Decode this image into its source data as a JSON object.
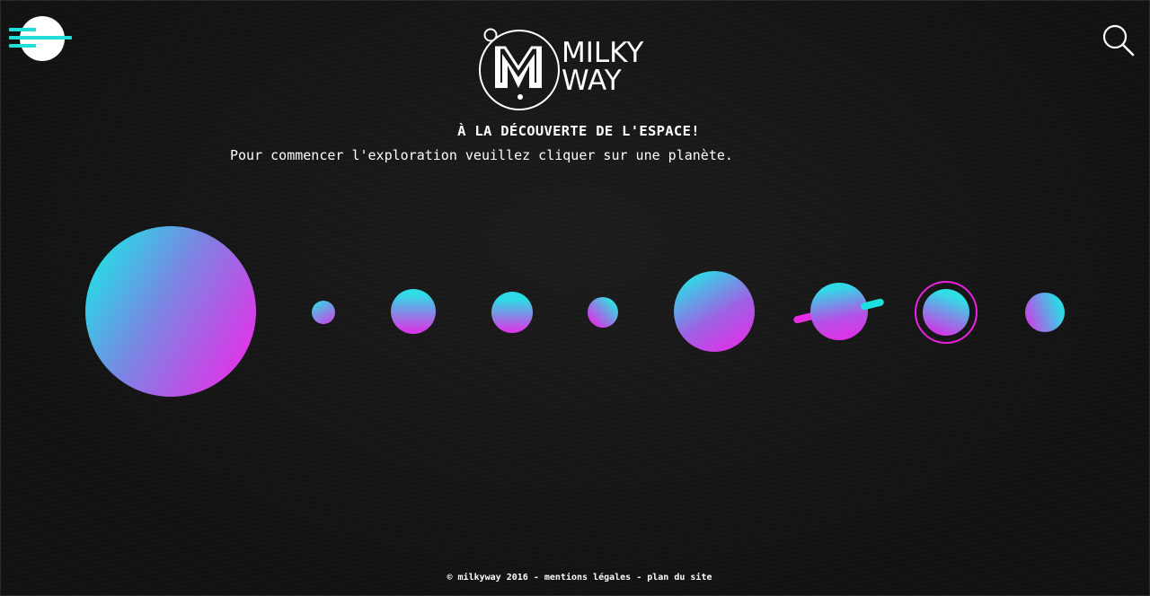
{
  "logo": {
    "line1": "MILKY",
    "line2": "WAY"
  },
  "hero": {
    "headline": "À LA DÉCOUVERTE DE L'ESPACE!",
    "subline": "Pour commencer l'exploration veuillez cliquer sur une planète."
  },
  "icons": {
    "menu": "menu-icon",
    "search": "search-icon",
    "logo": "milkyway-logo-icon"
  },
  "colors": {
    "background": "#141414",
    "cyan": "#2ae0e6",
    "magenta": "#e82ae6",
    "menu_bar": "#1fe0d8"
  },
  "footer": {
    "copyright": "© milkyway 2016",
    "sep1": " - ",
    "legal": "mentions légales",
    "sep2": " - ",
    "sitemap": "plan du site"
  }
}
